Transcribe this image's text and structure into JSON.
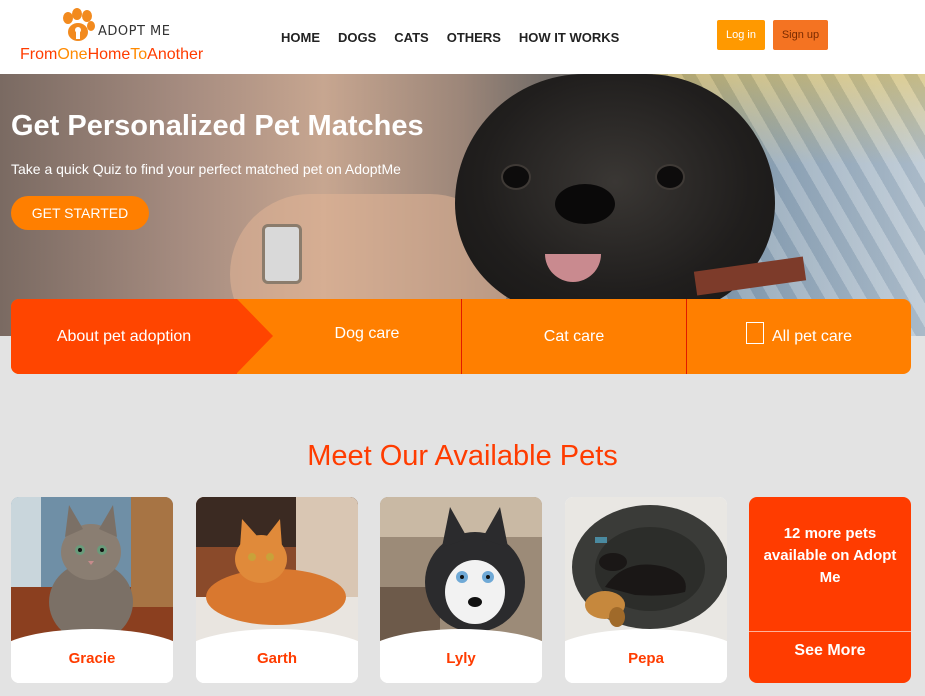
{
  "header": {
    "logo_name": "ADOPT ME",
    "tagline": [
      "From",
      "One",
      "Home",
      "To",
      "Another"
    ],
    "nav": [
      "HOME",
      "DOGS",
      "CATS",
      "OTHERS",
      "HOW IT WORKS"
    ],
    "login": "Log in",
    "signup": "Sign up"
  },
  "hero": {
    "title": "Get Personalized Pet Matches",
    "subtitle": "Take a quick Quiz to find your perfect matched pet on AdoptMe",
    "cta": "GET STARTED"
  },
  "care": {
    "about": "About pet adoption",
    "dog": "Dog care",
    "cat": "Cat care",
    "all": "All pet care"
  },
  "pets": {
    "title": "Meet Our Available Pets",
    "items": [
      {
        "name": "Gracie",
        "photo": "kitten"
      },
      {
        "name": "Garth",
        "photo": "orange-cat"
      },
      {
        "name": "Lyly",
        "photo": "husky-puppy"
      },
      {
        "name": "Pepa",
        "photo": "dachshund"
      }
    ],
    "more_text": "12 more pets available on Adopt Me",
    "see_more": "See More"
  },
  "colors": {
    "accent": "#ff3c00",
    "orange": "#ff7f00",
    "background": "#e3e3e3"
  }
}
